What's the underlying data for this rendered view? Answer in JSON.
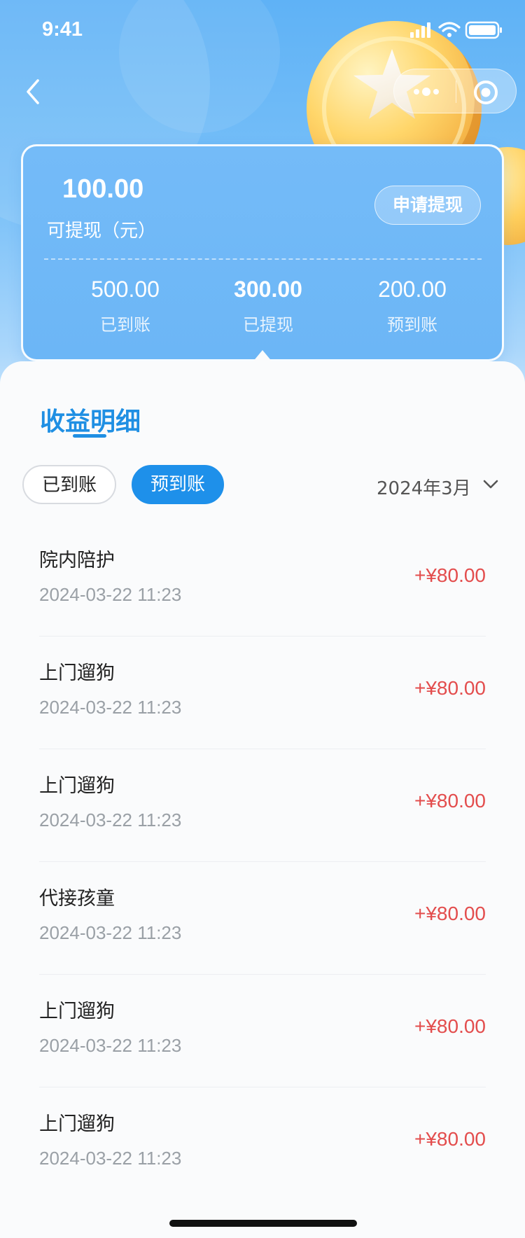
{
  "status_bar": {
    "time": "9:41"
  },
  "nav": {
    "back_icon": "chevron-left-icon",
    "more_icon": "more-dots-icon",
    "target_icon": "target-icon"
  },
  "summary": {
    "amount": "100.00",
    "amount_label": "可提现（元）",
    "withdraw_button": "申请提现",
    "stats": [
      {
        "value": "500.00",
        "label": "已到账"
      },
      {
        "value": "300.00",
        "label": "已提现"
      },
      {
        "value": "200.00",
        "label": "预到账"
      }
    ]
  },
  "details": {
    "title": "收益明细",
    "filters": [
      "已到账",
      "预到账"
    ],
    "active_filter": "预到账",
    "month": "2024年3月",
    "items": [
      {
        "name": "院内陪护",
        "time": "2024-03-22 11:23",
        "amount": "+¥80.00"
      },
      {
        "name": "上门遛狗",
        "time": "2024-03-22 11:23",
        "amount": "+¥80.00"
      },
      {
        "name": "上门遛狗",
        "time": "2024-03-22 11:23",
        "amount": "+¥80.00"
      },
      {
        "name": "代接孩童",
        "time": "2024-03-22 11:23",
        "amount": "+¥80.00"
      },
      {
        "name": "上门遛狗",
        "time": "2024-03-22 11:23",
        "amount": "+¥80.00"
      },
      {
        "name": "上门遛狗",
        "time": "2024-03-22 11:23",
        "amount": "+¥80.00"
      }
    ]
  },
  "colors": {
    "accent": "#1e90ea",
    "amount_positive": "#e34d4d",
    "hero_top": "#5fb2f6"
  }
}
